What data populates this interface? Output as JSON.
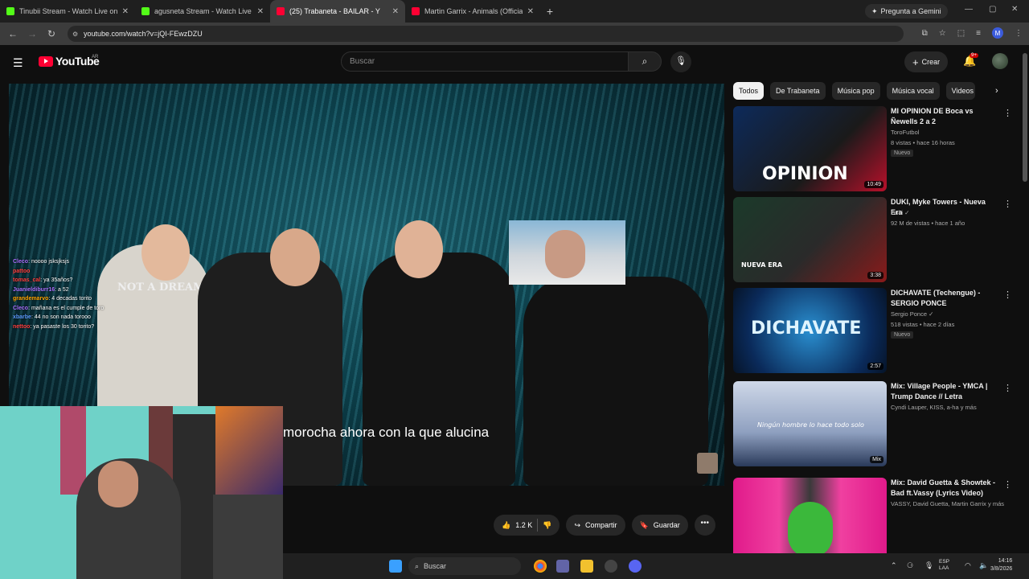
{
  "browser": {
    "tabs": [
      {
        "title": "Tinubii Stream - Watch Live on",
        "color": "#53fc18"
      },
      {
        "title": "agusneta Stream - Watch Live o",
        "color": "#53fc18"
      },
      {
        "title": "(25) Trabaneta - BAILAR - Y",
        "color": "#ff0033"
      },
      {
        "title": "Martin Garrix - Animals (Officia",
        "color": "#ff0033"
      }
    ],
    "new_tab": "+",
    "gemini": "Pregunta a Gemini",
    "url": "youtube.com/watch?v=jQI-FEwzDZU",
    "profile_initial": "M"
  },
  "header": {
    "logo_text": "YouTube",
    "country": "AR",
    "search_placeholder": "Buscar",
    "create_label": "Crear",
    "notif_count": "9+"
  },
  "video": {
    "subtitle": "morocha ahora con la que alucina",
    "shirt_text": "NOT A DREAM",
    "chat": [
      {
        "user": "Cleco",
        "msg": ": noooo jsksjksjs",
        "color": "#a970ff"
      },
      {
        "user": "pattoo",
        "msg": "",
        "color": "#ff4040"
      },
      {
        "user": "tomas_cal",
        "msg": ": ya 35años?",
        "color": "#ff4040"
      },
      {
        "user": "Juanieldiburr16",
        "msg": ": a 52",
        "color": "#a970ff"
      },
      {
        "user": "grandemarvo",
        "msg": ": 4 decadas torito",
        "color": "#ffa500"
      },
      {
        "user": "Cleco",
        "msg": ": mañana es el cumple de toro",
        "color": "#a970ff"
      },
      {
        "user": "xbarbe",
        "msg": ": 44 no son nada torooo",
        "color": "#5b9cff"
      },
      {
        "user": "nettoo",
        "msg": ": ya pasaste los 30 torito?",
        "color": "#ff4040"
      }
    ]
  },
  "actions": {
    "likes": "1.2 K",
    "share": "Compartir",
    "save": "Guardar"
  },
  "sidebar": {
    "chips": [
      "Todos",
      "De Trabaneta",
      "Música pop",
      "Música vocal",
      "Videos"
    ],
    "videos": [
      {
        "title": "MI OPINION DE Boca vs Ñewells 2 a 2",
        "channel": "ToroFutbol",
        "meta": "8 vistas • hace 16 horas",
        "badge": "Nuevo",
        "duration": "10:49",
        "thumb_text": "OPINION",
        "verified": ""
      },
      {
        "title": "DUKI, Myke Towers - Nueva Era",
        "channel": "Duki",
        "meta": "92 M de vistas • hace 1 año",
        "badge": "",
        "duration": "3:38",
        "thumb_text": "NUEVA ERA",
        "verified": "✓"
      },
      {
        "title": "DICHAVATE (Techengue) - SERGIO PONCE",
        "channel": "Sergio Ponce",
        "meta": "518 vistas • hace 2 días",
        "badge": "Nuevo",
        "duration": "2:57",
        "thumb_text": "DICHAVATE",
        "verified": "✓"
      },
      {
        "title": "Mix: Village People - YMCA | Trump Dance // Letra",
        "channel": "Cyndi Lauper, KISS, a-ha y más",
        "meta": "",
        "badge": "",
        "duration": "Mix",
        "thumb_text": "Ningún hombre lo hace todo solo",
        "verified": ""
      },
      {
        "title": "Mix: David Guetta & Showtek - Bad ft.Vassy (Lyrics Video)",
        "channel": "VASSY, David Guetta, Martin Garrix y más",
        "meta": "",
        "badge": "",
        "duration": "",
        "thumb_text": "",
        "verified": ""
      }
    ]
  },
  "taskbar": {
    "search": "Buscar",
    "lang1": "ESP",
    "lang2": "LAA",
    "time": "14:16",
    "date": "3/8/2026"
  }
}
